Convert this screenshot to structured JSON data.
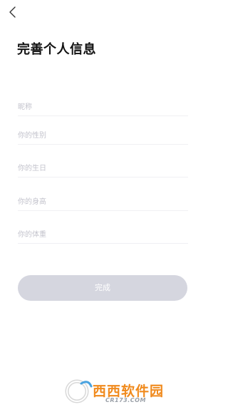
{
  "header": {
    "back_icon": "chevron-left-icon",
    "title": "完善个人信息"
  },
  "form": {
    "nickname_placeholder": "昵称",
    "gender_placeholder": "你的性别",
    "birthday_placeholder": "你的生日",
    "height_placeholder": "你的身高",
    "weight_placeholder": "你的体重"
  },
  "submit": {
    "label": "完成"
  },
  "watermark": {
    "name": "西西软件园",
    "domain": "CR173.COM"
  },
  "colors": {
    "button_bg": "#d5d6df",
    "placeholder": "#c3c3cc",
    "divider": "#f0f0f3"
  }
}
